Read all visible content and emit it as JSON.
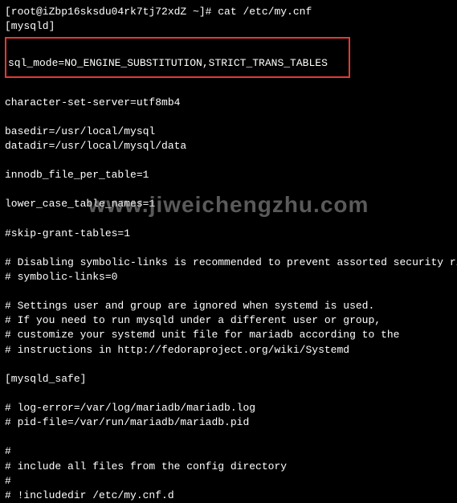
{
  "prompt": "[root@iZbp16sksdu04rk7tj72xdZ ~]# cat /etc/my.cnf",
  "lines": {
    "l1": "[mysqld]",
    "l2": "sql_mode=NO_ENGINE_SUBSTITUTION,STRICT_TRANS_TABLES",
    "l3": "character-set-server=utf8mb4",
    "l4": "basedir=/usr/local/mysql",
    "l5": "datadir=/usr/local/mysql/data",
    "l6": "innodb_file_per_table=1",
    "l7": "lower_case_table_names=1",
    "l8": "#skip-grant-tables=1",
    "l9": "# Disabling symbolic-links is recommended to prevent assorted security risks",
    "l10": "# symbolic-links=0",
    "l11": "# Settings user and group are ignored when systemd is used.",
    "l12": "# If you need to run mysqld under a different user or group,",
    "l13": "# customize your systemd unit file for mariadb according to the",
    "l14": "# instructions in http://fedoraproject.org/wiki/Systemd",
    "l15": "[mysqld_safe]",
    "l16": "# log-error=/var/log/mariadb/mariadb.log",
    "l17": "# pid-file=/var/run/mariadb/mariadb.pid",
    "l18": "#",
    "l19": "# include all files from the config directory",
    "l20": "#",
    "l21": "# !includedir /etc/my.cnf.d"
  },
  "watermark": "www.jiweichengzhu.com"
}
